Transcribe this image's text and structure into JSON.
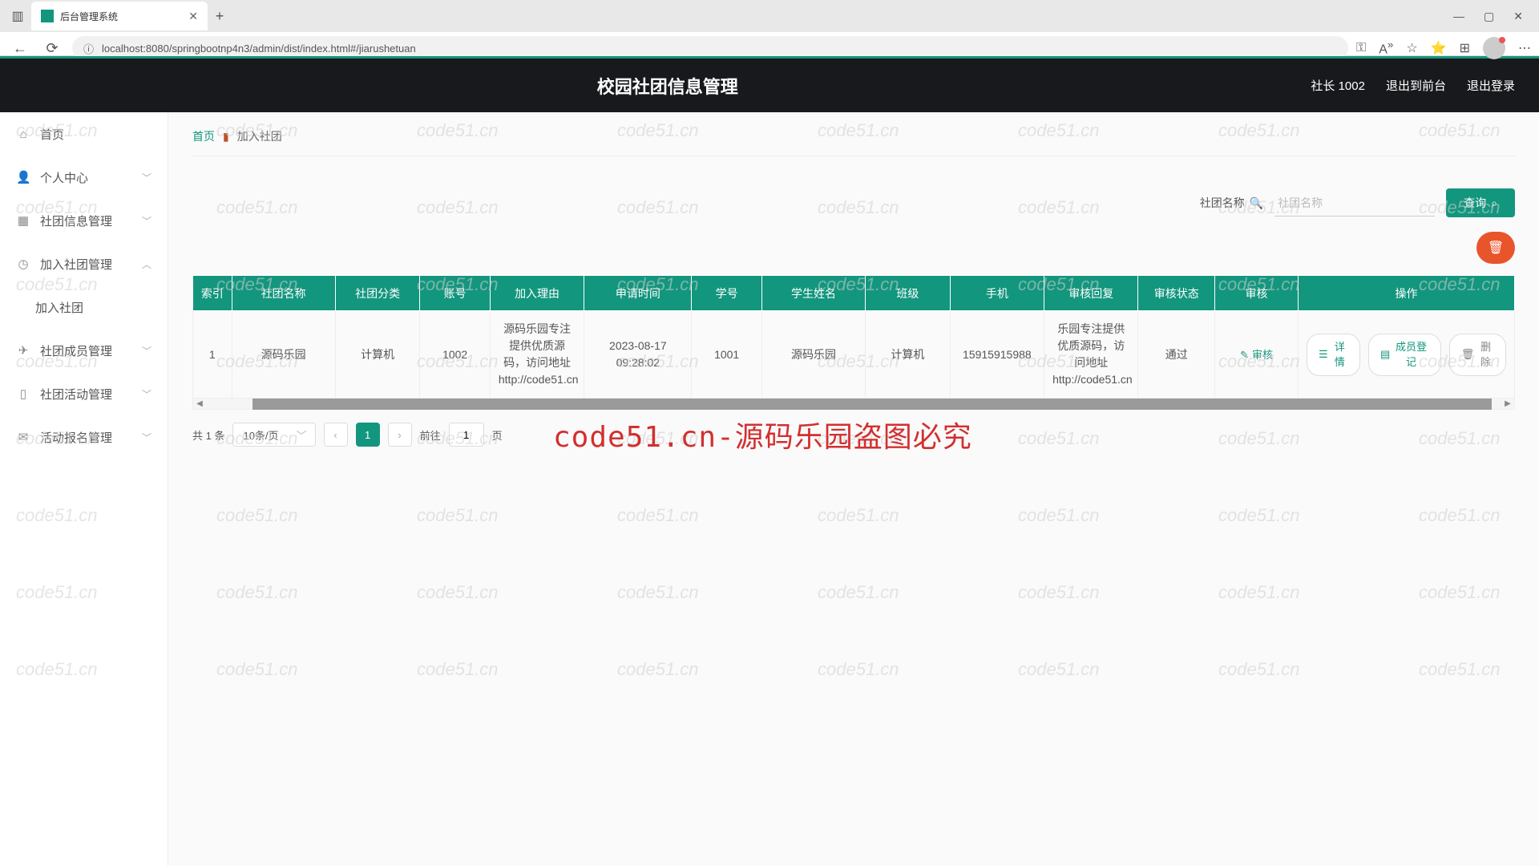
{
  "browser": {
    "tab_title": "后台管理系统",
    "url": "localhost:8080/springbootnp4n3/admin/dist/index.html#/jiarushetuan"
  },
  "header": {
    "title": "校园社团信息管理",
    "user": "社长 1002",
    "back_front": "退出到前台",
    "logout": "退出登录"
  },
  "sidebar": {
    "items": [
      {
        "icon": "⌂",
        "label": "首页",
        "chev": ""
      },
      {
        "icon": "👤",
        "label": "个人中心",
        "chev": "﹀"
      },
      {
        "icon": "▦",
        "label": "社团信息管理",
        "chev": "﹀"
      },
      {
        "icon": "◷",
        "label": "加入社团管理",
        "chev": "︿"
      },
      {
        "icon": "",
        "label": "加入社团",
        "chev": "",
        "sub": true
      },
      {
        "icon": "✈",
        "label": "社团成员管理",
        "chev": "﹀"
      },
      {
        "icon": "▯",
        "label": "社团活动管理",
        "chev": "﹀"
      },
      {
        "icon": "✉",
        "label": "活动报名管理",
        "chev": "﹀"
      }
    ]
  },
  "breadcrumb": {
    "home": "首页",
    "current": "加入社团"
  },
  "search": {
    "label": "社团名称",
    "placeholder": "社团名称",
    "button": "查询"
  },
  "table": {
    "headers": [
      "索引",
      "社团名称",
      "社团分类",
      "账号",
      "加入理由",
      "申请时间",
      "学号",
      "学生姓名",
      "班级",
      "手机",
      "审核回复",
      "审核状态",
      "审核",
      "操作"
    ],
    "row": {
      "index": "1",
      "name": "源码乐园",
      "category": "计算机",
      "account": "1002",
      "reason": "源码乐园专注提供优质源码，访问地址http://code51.cn",
      "apply_time": "2023-08-17 09:28:02",
      "student_no": "1001",
      "student_name": "源码乐园",
      "class": "计算机",
      "phone": "15915915988",
      "review_reply": "乐园专注提供优质源码，访问地址http://code51.cn",
      "review_status": "通过"
    },
    "actions": {
      "audit": "审核",
      "detail": "详情",
      "register": "成员登记",
      "delete": "删除"
    }
  },
  "pager": {
    "total": "共 1 条",
    "page_size": "10条/页",
    "current": "1",
    "goto_label": "前往",
    "goto_value": "1",
    "page_suffix": "页"
  },
  "overlay": "code51.cn-源码乐园盗图必究",
  "watermark": "code51.cn"
}
